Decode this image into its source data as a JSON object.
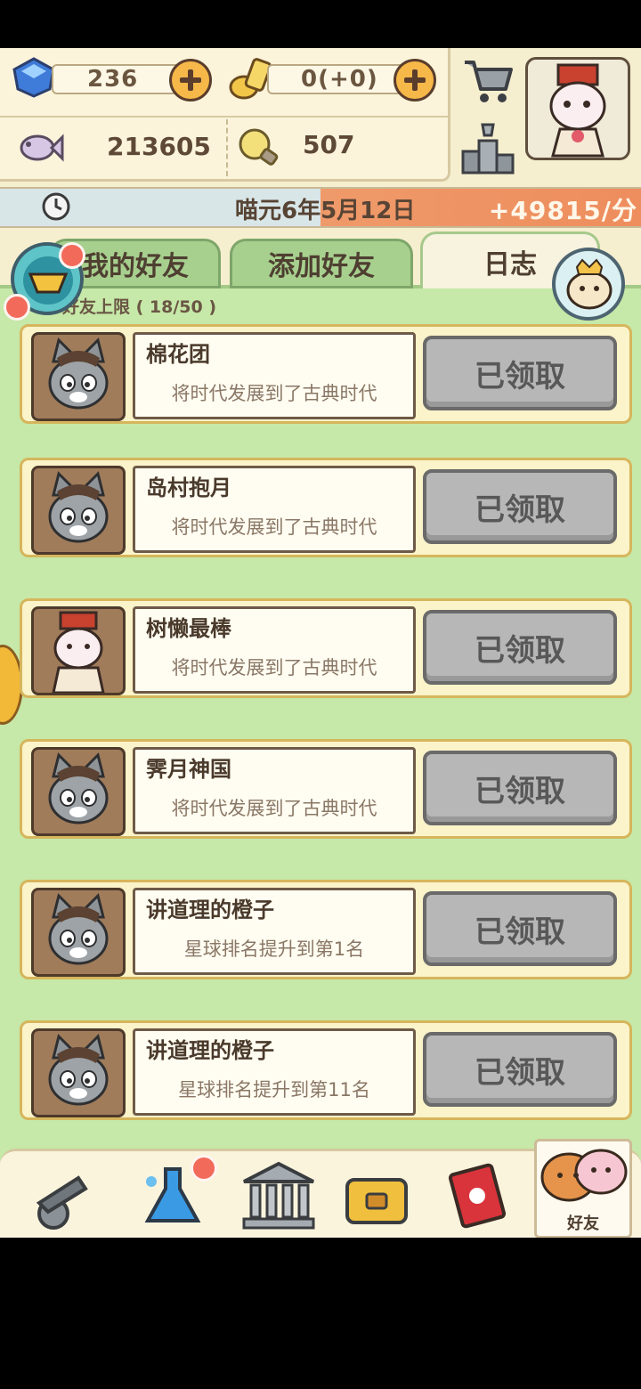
{
  "resources": {
    "gems": "236",
    "gold": "0(+0)",
    "fish": "213605",
    "ideas": "507"
  },
  "date_bar": {
    "date": "喵元6年5月12日",
    "rate": "+49815/分"
  },
  "tabs": [
    {
      "label": "我的好友",
      "active": false
    },
    {
      "label": "添加好友",
      "active": false
    },
    {
      "label": "日志",
      "active": true
    }
  ],
  "friend_limit": "好友上限 ( 18/50 )",
  "log_entries": [
    {
      "name": "棉花团",
      "desc": "将时代发展到了古典时代",
      "button": "已领取",
      "avatar": "gray-cat"
    },
    {
      "name": "岛村抱月",
      "desc": "将时代发展到了古典时代",
      "button": "已领取",
      "avatar": "gray-cat"
    },
    {
      "name": "树懒最棒",
      "desc": "将时代发展到了古典时代",
      "button": "已领取",
      "avatar": "opera-cat"
    },
    {
      "name": "霁月神国",
      "desc": "将时代发展到了古典时代",
      "button": "已领取",
      "avatar": "gray-cat"
    },
    {
      "name": "讲道理的橙子",
      "desc": "星球排名提升到第1名",
      "button": "已领取",
      "avatar": "gray-cat"
    },
    {
      "name": "讲道理的橙子",
      "desc": "星球排名提升到第11名",
      "button": "已领取",
      "avatar": "gray-cat"
    }
  ],
  "bottom_nav": {
    "friends_label": "好友",
    "items": [
      "cannon-icon",
      "potion-icon",
      "museum-icon",
      "treasure-chest-icon",
      "book-icon",
      "friends-icon"
    ]
  },
  "colors": {
    "accent_orange": "#ef9a6a",
    "list_green": "#c6e8a8",
    "button_gray": "#b7b7b7"
  }
}
